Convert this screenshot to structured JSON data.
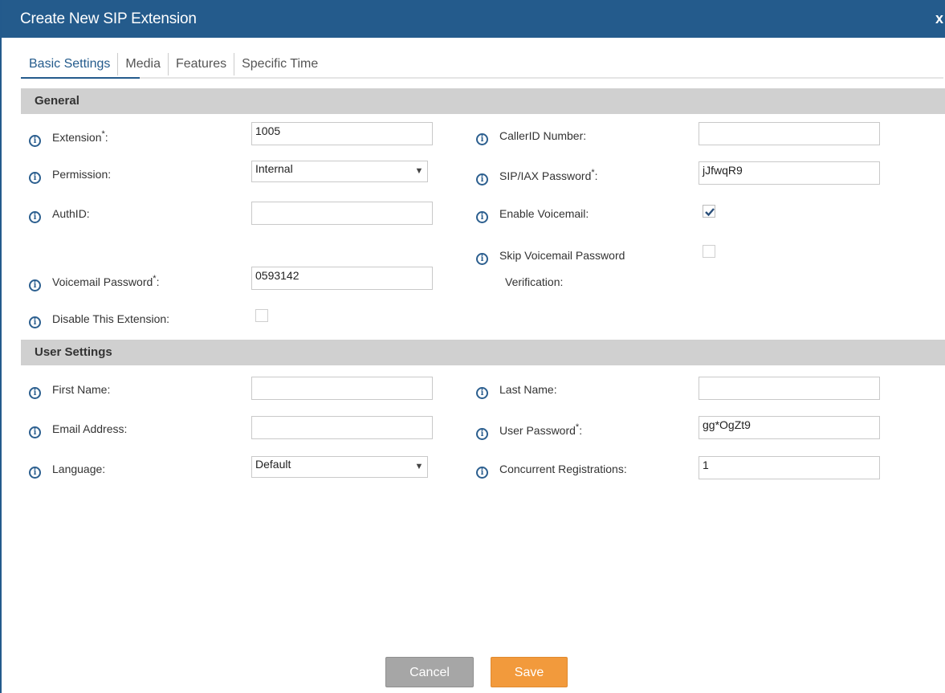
{
  "dialog": {
    "title": "Create New SIP Extension",
    "close_label": "x"
  },
  "tabs": [
    {
      "label": "Basic Settings"
    },
    {
      "label": "Media"
    },
    {
      "label": "Features"
    },
    {
      "label": "Specific Time"
    }
  ],
  "sections": {
    "general": "General",
    "user_settings": "User Settings"
  },
  "general": {
    "extension": {
      "label": "Extension",
      "value": "1005",
      "required": "*",
      "suffix": ":"
    },
    "permission": {
      "label": "Permission:",
      "value": "Internal"
    },
    "authid": {
      "label": "AuthID:",
      "value": ""
    },
    "voicemail_password": {
      "label": "Voicemail Password",
      "value": "0593142",
      "required": "*",
      "suffix": ":"
    },
    "disable_extension": {
      "label": "Disable This Extension:",
      "checked": false
    },
    "callerid_number": {
      "label": "CallerID Number:",
      "value": ""
    },
    "sip_iax_password": {
      "label": "SIP/IAX Password",
      "value": "jJfwqR9",
      "required": "*",
      "suffix": ":"
    },
    "enable_voicemail": {
      "label": "Enable Voicemail:",
      "checked": true
    },
    "skip_voicemail_verification": {
      "label_line1": "Skip Voicemail Password",
      "label_line2": "Verification:",
      "checked": false
    }
  },
  "user_settings": {
    "first_name": {
      "label": "First Name:",
      "value": ""
    },
    "email": {
      "label": "Email Address:",
      "value": ""
    },
    "language": {
      "label": "Language:",
      "value": "Default"
    },
    "last_name": {
      "label": "Last Name:",
      "value": ""
    },
    "user_password": {
      "label": "User Password",
      "value": "gg*OgZt9",
      "required": "*",
      "suffix": ":"
    },
    "concurrent_registrations": {
      "label": "Concurrent Registrations:",
      "value": "1"
    }
  },
  "buttons": {
    "cancel": "Cancel",
    "save": "Save"
  },
  "icons": {
    "info": "info-icon",
    "check": "checkmark-icon",
    "dropdown": "chevron-down-icon"
  },
  "colors": {
    "titlebar": "#245b8c",
    "save": "#f29a3c",
    "cancel": "#a6a6a6",
    "section": "#d0d0d0"
  }
}
